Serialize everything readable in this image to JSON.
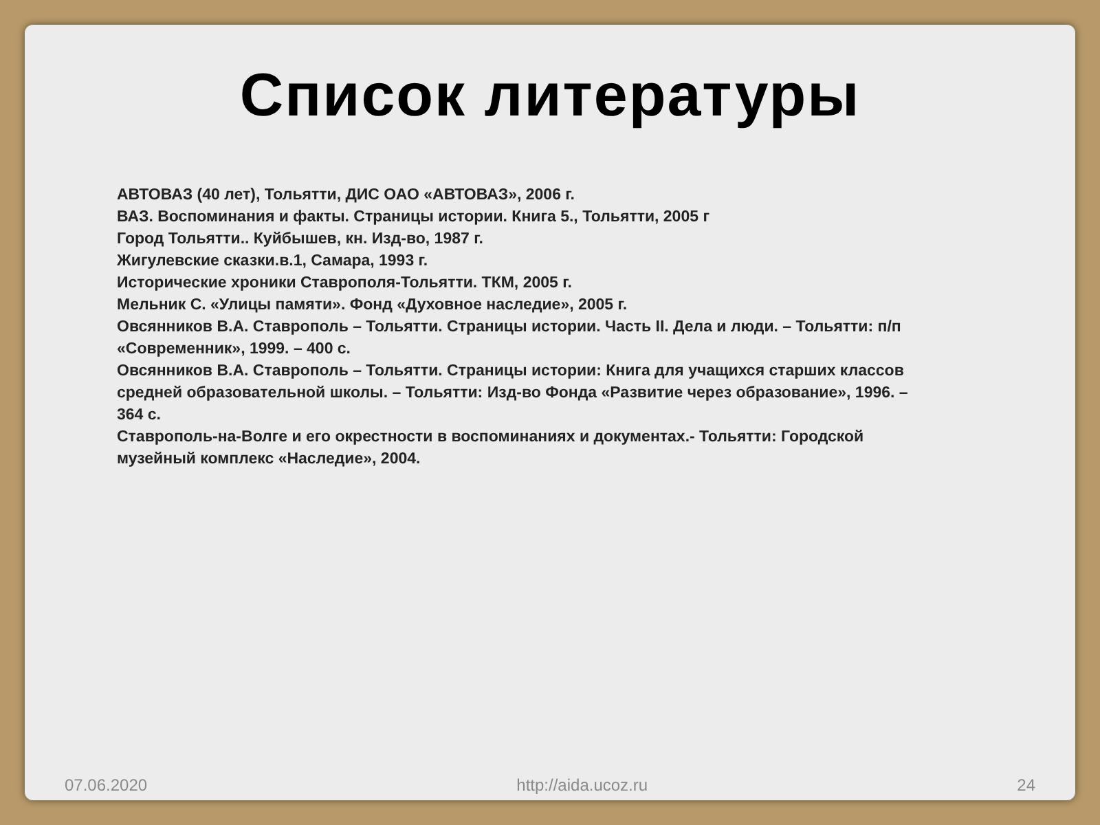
{
  "slide": {
    "title": "Список литературы",
    "references": [
      "АВТОВАЗ (40 лет), Тольятти, ДИС ОАО «АВТОВАЗ», 2006 г.",
      "ВАЗ. Воспоминания и факты. Страницы истории. Книга 5., Тольятти, 2005 г",
      "Город Тольятти.. Куйбышев, кн. Изд-во, 1987 г.",
      "Жигулевские сказки.в.1, Самара, 1993 г.",
      "Исторические хроники Ставрополя-Тольятти. ТКМ, 2005 г.",
      "Мельник С. «Улицы памяти». Фонд «Духовное наследие», 2005 г.",
      "Овсянников В.А. Ставрополь – Тольятти. Страницы истории. Часть II. Дела и люди. – Тольятти: п/п «Современник», 1999. – 400 с.",
      "Овсянников В.А. Ставрополь – Тольятти. Страницы истории: Книга для учащихся старших классов средней образовательной школы. – Тольятти: Изд-во Фонда «Развитие через образование», 1996. – 364 с.",
      "Ставрополь-на-Волге и его окрестности в воспоминаниях и документах.- Тольятти: Городской музейный комплекс «Наследие», 2004."
    ],
    "footer": {
      "date": "07.06.2020",
      "url": "http://aida.ucoz.ru",
      "page": "24"
    }
  }
}
